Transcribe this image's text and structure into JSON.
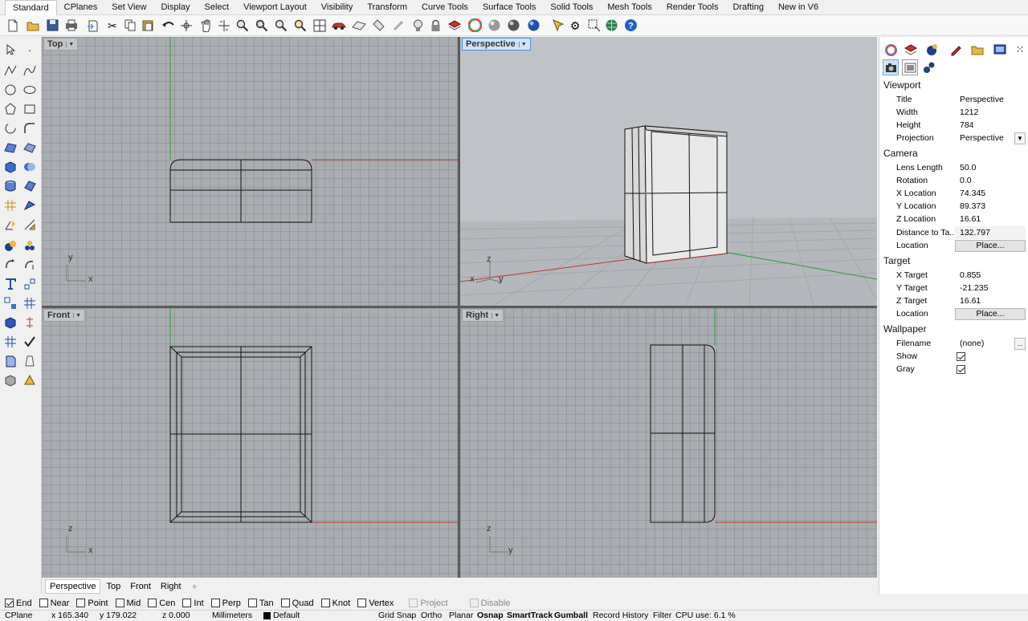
{
  "ribbon_tabs": [
    "Standard",
    "CPlanes",
    "Set View",
    "Display",
    "Select",
    "Viewport Layout",
    "Visibility",
    "Transform",
    "Curve Tools",
    "Surface Tools",
    "Solid Tools",
    "Mesh Tools",
    "Render Tools",
    "Drafting",
    "New in V6"
  ],
  "active_tab": "Standard",
  "toolbar_icons": [
    "new-icon",
    "open-icon",
    "save-icon",
    "print-icon",
    "import-icon",
    "cut-icon",
    "copy-icon",
    "paste-icon",
    "undo-icon",
    "pan-select-icon",
    "pan-icon",
    "rotate-view-icon",
    "zoom-icon",
    "zoom-window-icon",
    "zoom-extents-icon",
    "zoom-selected-icon",
    "zoom-undo-icon",
    "four-viewports-icon",
    "car-icon",
    "cplane-icon",
    "light-icon",
    "lock-icon",
    "layer-icon",
    "color-wheel-icon",
    "material-sphere-icon",
    "render-sphere-icon",
    "render-blue-icon",
    "point-edit-icon",
    "gear-icon",
    "select-icon",
    "globe-icon",
    "help-icon"
  ],
  "viewports": {
    "top": {
      "label": "Top",
      "axis_h": "x",
      "axis_v": "y"
    },
    "perspective": {
      "label": "Perspective",
      "axis_x": "x",
      "axis_y": "y",
      "axis_z": "z"
    },
    "front": {
      "label": "Front",
      "axis_h": "x",
      "axis_v": "z"
    },
    "right": {
      "label": "Right",
      "axis_h": "y",
      "axis_v": "z"
    }
  },
  "viewport_tabs": [
    "Perspective",
    "Top",
    "Front",
    "Right"
  ],
  "active_viewport_tab": "Perspective",
  "viewport_tabs_add": "+",
  "panel": {
    "icons": [
      "color-wheel-icon",
      "layers-icon",
      "materials-icon",
      "pen-icon",
      "folder-icon",
      "display-icon",
      "settings-icon",
      "camera-icon",
      "viewport-icon",
      "rendering-icon"
    ],
    "viewport_header": "Viewport",
    "title_label": "Title",
    "title_value": "Perspective",
    "width_label": "Width",
    "width_value": "1212",
    "height_label": "Height",
    "height_value": "784",
    "projection_label": "Projection",
    "projection_value": "Perspective",
    "camera_header": "Camera",
    "lens_label": "Lens Length",
    "lens_value": "50.0",
    "rotation_label": "Rotation",
    "rotation_value": "0.0",
    "xloc_label": "X Location",
    "xloc_value": "74.345",
    "yloc_label": "Y Location",
    "yloc_value": "89.373",
    "zloc_label": "Z Location",
    "zloc_value": "16.61",
    "dist_label": "Distance to Ta...",
    "dist_value": "132.797",
    "location_label": "Location",
    "place_button": "Place...",
    "target_header": "Target",
    "xt_label": "X Target",
    "xt_value": "0.855",
    "yt_label": "Y Target",
    "yt_value": "-21.235",
    "zt_label": "Z Target",
    "zt_value": "16.61",
    "target_location_label": "Location",
    "target_place_button": "Place...",
    "wallpaper_header": "Wallpaper",
    "filename_label": "Filename",
    "filename_value": "(none)",
    "filename_button": "...",
    "show_label": "Show",
    "show_checked": true,
    "gray_label": "Gray",
    "gray_checked": true
  },
  "osnaps": [
    {
      "label": "End",
      "checked": true
    },
    {
      "label": "Near",
      "checked": false
    },
    {
      "label": "Point",
      "checked": false
    },
    {
      "label": "Mid",
      "checked": false
    },
    {
      "label": "Cen",
      "checked": false
    },
    {
      "label": "Int",
      "checked": false
    },
    {
      "label": "Perp",
      "checked": false
    },
    {
      "label": "Tan",
      "checked": false
    },
    {
      "label": "Quad",
      "checked": false
    },
    {
      "label": "Knot",
      "checked": false
    },
    {
      "label": "Vertex",
      "checked": false
    }
  ],
  "osnap_extra": [
    {
      "label": "Project",
      "checked": false
    },
    {
      "label": "Disable",
      "checked": false
    }
  ],
  "status": {
    "cplane": "CPlane",
    "x": "x 165.340",
    "y": "y 179.022",
    "z": "z 0.000",
    "units": "Millimeters",
    "layer": "Default",
    "grid_snap": "Grid Snap",
    "ortho": "Ortho",
    "planar": "Planar",
    "osnap": "Osnap",
    "smarttrack": "SmartTrack",
    "gumball": "Gumball",
    "record_history": "Record History",
    "filter": "Filter",
    "cpu": "CPU use: 6.1 %"
  }
}
